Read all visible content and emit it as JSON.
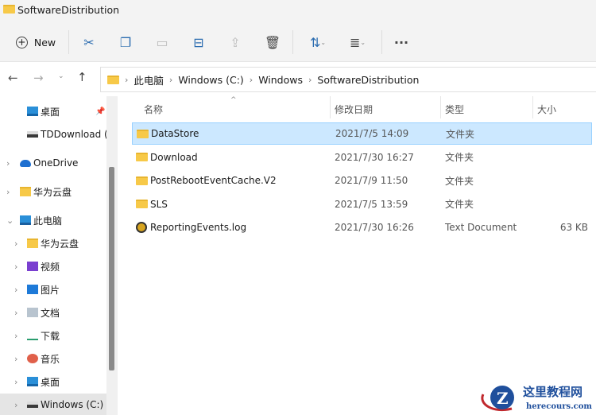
{
  "window": {
    "title": "SoftwareDistribution"
  },
  "toolbar": {
    "new_label": "New",
    "icons": [
      "cut-icon",
      "copy-icon",
      "paste-icon",
      "rename-icon",
      "share-icon",
      "delete-icon",
      "sort-icon",
      "view-icon",
      "more-icon"
    ]
  },
  "nav": {
    "breadcrumb": [
      "此电脑",
      "Windows (C:)",
      "Windows",
      "SoftwareDistribution"
    ]
  },
  "sidebar": {
    "items": [
      {
        "label": "桌面",
        "indent": 2,
        "icon": "desktop",
        "pinned": true
      },
      {
        "label": "TDDownload (\\",
        "indent": 2,
        "icon": "drive"
      },
      {
        "label": "OneDrive",
        "indent": 1,
        "icon": "cloud",
        "chev": "›"
      },
      {
        "label": "华为云盘",
        "indent": 1,
        "icon": "folder",
        "chev": "›"
      },
      {
        "label": "此电脑",
        "indent": 1,
        "icon": "pc",
        "chev": "⌄"
      },
      {
        "label": "华为云盘",
        "indent": 2,
        "icon": "folder",
        "chev": "›"
      },
      {
        "label": "视频",
        "indent": 2,
        "icon": "video",
        "chev": "›"
      },
      {
        "label": "图片",
        "indent": 2,
        "icon": "pictures",
        "chev": "›"
      },
      {
        "label": "文档",
        "indent": 2,
        "icon": "documents",
        "chev": "›"
      },
      {
        "label": "下载",
        "indent": 2,
        "icon": "download",
        "chev": "›"
      },
      {
        "label": "音乐",
        "indent": 2,
        "icon": "music",
        "chev": "›"
      },
      {
        "label": "桌面",
        "indent": 2,
        "icon": "desktop",
        "chev": "›"
      },
      {
        "label": "Windows (C:)",
        "indent": 2,
        "icon": "drive",
        "chev": "›",
        "selected": true
      }
    ]
  },
  "columns": {
    "name": "名称",
    "modified": "修改日期",
    "type": "类型",
    "size": "大小"
  },
  "files": [
    {
      "name": "DataStore",
      "modified": "2021/7/5 14:09",
      "type": "文件夹",
      "size": "",
      "selected": true,
      "icon": "folder"
    },
    {
      "name": "Download",
      "modified": "2021/7/30 16:27",
      "type": "文件夹",
      "size": "",
      "icon": "folder"
    },
    {
      "name": "PostRebootEventCache.V2",
      "modified": "2021/7/9 11:50",
      "type": "文件夹",
      "size": "",
      "icon": "folder"
    },
    {
      "name": "SLS",
      "modified": "2021/7/5 13:59",
      "type": "文件夹",
      "size": "",
      "icon": "folder"
    },
    {
      "name": "ReportingEvents.log",
      "modified": "2021/7/30 16:26",
      "type": "Text Document",
      "size": "63 KB",
      "icon": "log"
    }
  ],
  "watermark": {
    "title": "这里教程网",
    "url": "herecours.com"
  }
}
